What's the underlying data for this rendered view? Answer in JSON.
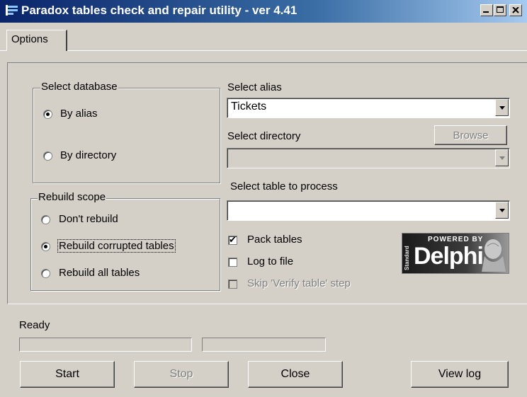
{
  "window": {
    "title": "Paradox tables check and repair utility - ver 4.41",
    "minimize_icon": "minimize-icon",
    "maximize_icon": "maximize-icon",
    "close_icon": "close-icon"
  },
  "tabs": [
    {
      "label": "Options",
      "active": true
    }
  ],
  "select_database": {
    "title": "Select database",
    "options": [
      {
        "label": "By alias",
        "selected": true
      },
      {
        "label": "By directory",
        "selected": false
      }
    ]
  },
  "rebuild_scope": {
    "title": "Rebuild scope",
    "options": [
      {
        "label": "Don't rebuild",
        "selected": false
      },
      {
        "label": "Rebuild corrupted tables",
        "selected": true
      },
      {
        "label": "Rebuild all tables",
        "selected": false
      }
    ]
  },
  "alias": {
    "label": "Select alias",
    "value": "Tickets"
  },
  "directory": {
    "label": "Select directory",
    "value": "",
    "browse_label": "Browse"
  },
  "table": {
    "label": "Select table to process",
    "value": ""
  },
  "options": {
    "pack_tables": {
      "label": "Pack tables",
      "checked": true
    },
    "log_to_file": {
      "label": "Log to file",
      "checked": false
    },
    "skip_verify": {
      "label": "Skip 'Verify table' step",
      "checked": false,
      "enabled": false
    }
  },
  "logo": {
    "line1": "POWERED BY",
    "line2": "Delphi",
    "side": "Standard"
  },
  "status": {
    "text": "Ready"
  },
  "buttons": {
    "start": "Start",
    "stop": "Stop",
    "close": "Close",
    "view_log": "View log"
  },
  "colors": {
    "titlebar_start": "#0a246a",
    "titlebar_end": "#a6caf0",
    "face": "#d4d0c8"
  }
}
